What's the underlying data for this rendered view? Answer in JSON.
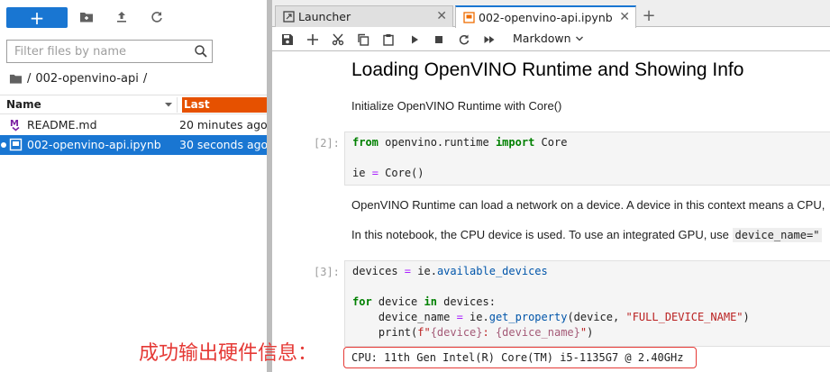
{
  "file_browser": {
    "new_button_label": "+",
    "filter_placeholder": "Filter files by name",
    "breadcrumb": {
      "separator_1": "/",
      "folder": "002-openvino-api",
      "separator_2": "/"
    },
    "columns": {
      "name": "Name",
      "last_modified": "Last Modified"
    },
    "files": [
      {
        "name": "README.md",
        "modified": "20 minutes ago",
        "icon": "markdown-icon",
        "selected": false,
        "running": false
      },
      {
        "name": "002-openvino-api.ipynb",
        "modified": "30 seconds ago",
        "icon": "notebook-icon",
        "selected": true,
        "running": true
      }
    ]
  },
  "tabs": [
    {
      "label": "Launcher",
      "icon": "launcher-icon",
      "active": false,
      "close": "✕"
    },
    {
      "label": "002-openvino-api.ipynb",
      "icon": "notebook-icon",
      "active": true,
      "close": "✕"
    }
  ],
  "tab_add_label": "+",
  "notebook_toolbar": {
    "cell_type": "Markdown",
    "icons": [
      "save-icon",
      "add-cell-icon",
      "cut-icon",
      "copy-icon",
      "paste-icon",
      "run-icon",
      "stop-icon",
      "restart-icon",
      "fast-forward-icon"
    ]
  },
  "notebook": {
    "heading": "Loading OpenVINO Runtime and Showing Info",
    "md1": "Initialize OpenVINO Runtime with Core()",
    "cell2_prompt": "[2]:",
    "cell2": {
      "l1_kw1": "from",
      "l1_mod": " openvino.runtime ",
      "l1_kw2": "import",
      "l1_name": " Core",
      "l2_a": "ie ",
      "l2_op": "=",
      "l2_b": " Core()"
    },
    "md2": "OpenVINO Runtime can load a network on a device. A device in this context means a CPU,",
    "md3_prefix": "In this notebook, the CPU device is used. To use an integrated GPU, use ",
    "md3_code": "device_name=\"",
    "cell3_prompt": "[3]:",
    "cell3": {
      "l1_a": "devices ",
      "l1_op": "=",
      "l1_b": " ie.",
      "l1_fn": "available_devices",
      "l2_kw1": "for",
      "l2_a": " device ",
      "l2_kw2": "in",
      "l2_b": " devices:",
      "l3_a": "    device_name ",
      "l3_op": "=",
      "l3_b": " ie.",
      "l3_fn": "get_property",
      "l3_c": "(device, ",
      "l3_str": "\"FULL_DEVICE_NAME\"",
      "l3_d": ")",
      "l4_a": "    print(",
      "l4_str1": "f\"",
      "l4_br1": "{device}",
      "l4_str2": ": ",
      "l4_br2": "{device_name}",
      "l4_str3": "\"",
      "l4_b": ")"
    },
    "output": "CPU: 11th Gen Intel(R) Core(TM) i5-1135G7 @ 2.40GHz"
  },
  "annotation": "成功输出硬件信息："
}
